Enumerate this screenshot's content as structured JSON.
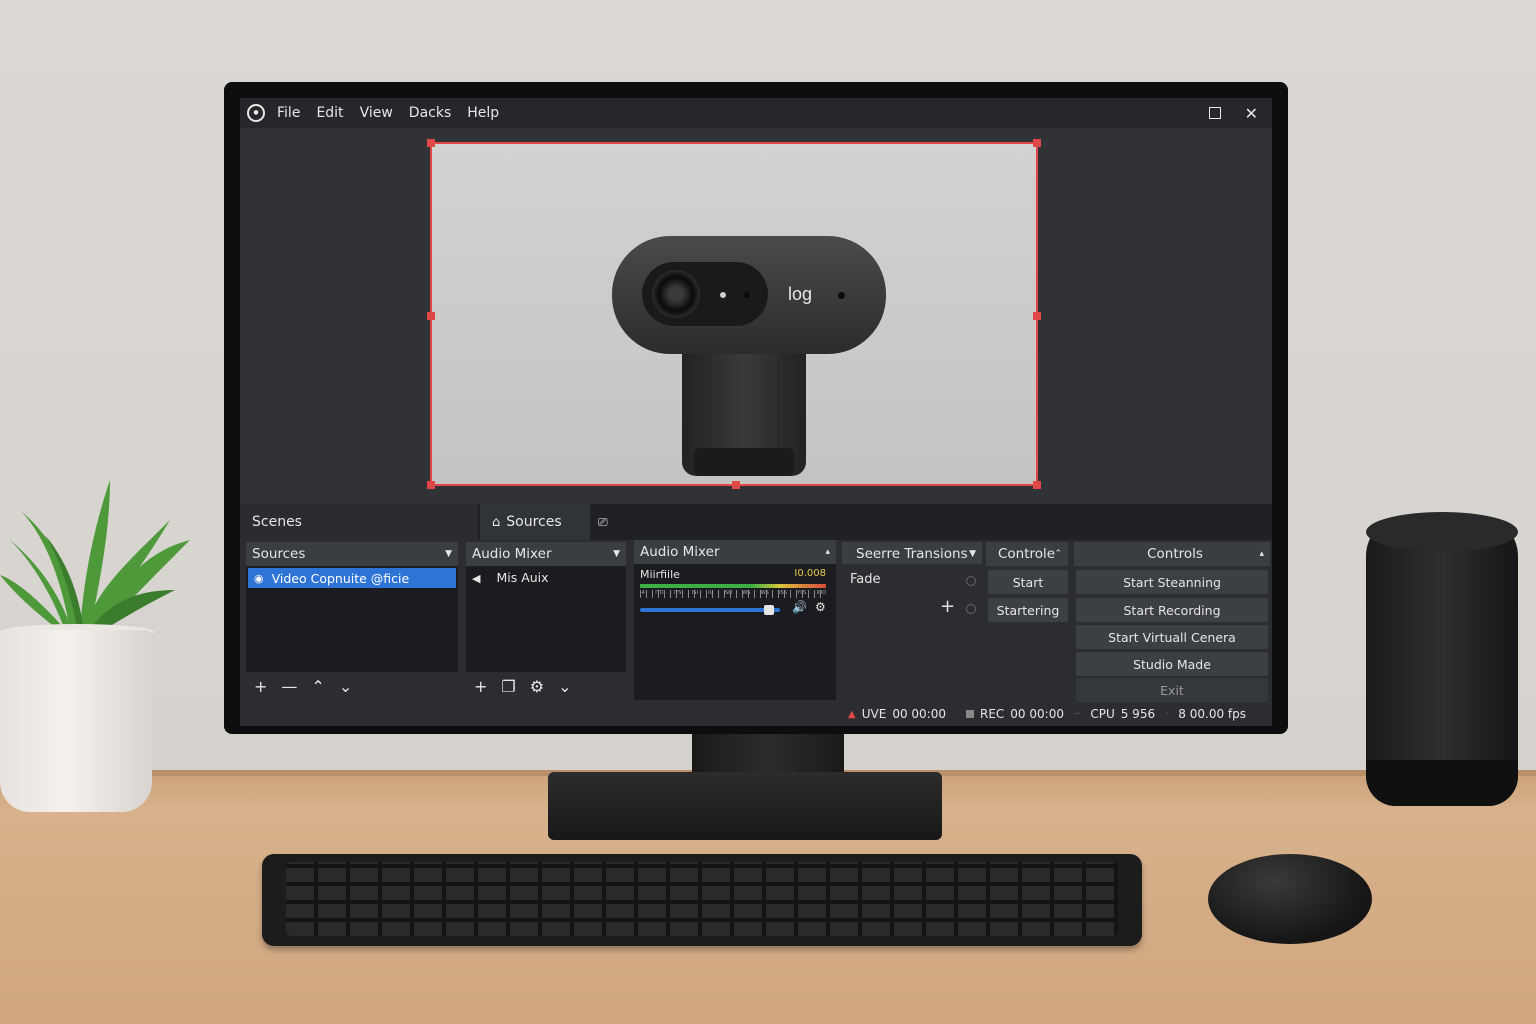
{
  "menu": {
    "items": [
      "File",
      "Edit",
      "View",
      "Dacks",
      "Help"
    ],
    "close_glyph": "✕"
  },
  "preview": {
    "cam_brand": "log"
  },
  "docks": {
    "scenes_tab": "Scenes",
    "sources_tab": "Sources"
  },
  "sources_panel": {
    "title": "Sources",
    "items": [
      "Video Copnuite @ficie"
    ]
  },
  "audio_mixer_panel": {
    "title": "Audio Mixer",
    "items": [
      "Mis Auix"
    ]
  },
  "audio_mixer_meter": {
    "title": "Audio Mixer",
    "channel_name": "Miirfiile",
    "level_readout": "I0.008",
    "tick_labels": [
      "-4",
      "ITD",
      "ITS",
      "ISI",
      "IU",
      "ISO",
      "WS",
      "WS",
      "ISS",
      "YIIS",
      "IOO"
    ]
  },
  "transitions_panel": {
    "title": "Seerre Transions",
    "selected": "Fade",
    "plus_glyph": "+"
  },
  "controle_panel": {
    "title": "Controle",
    "buttons": [
      "Start",
      "Startering"
    ]
  },
  "controls_panel": {
    "title": "Controls",
    "buttons": [
      "Start Steanning",
      "Start Recording",
      "Start Virtuall Cenera",
      "Studio Made",
      "Exit"
    ]
  },
  "statusbar": {
    "live_label": "UVE",
    "live_time": "00 00:00",
    "rec_label": "REC",
    "rec_time": "00 00:00",
    "cpu_label": "CPU",
    "cpu_value": "5 956",
    "fps_value": "8 00.00 fps"
  },
  "icons": {
    "app": "obs-logo-icon",
    "scene_tab": "house-icon",
    "extra_dock": "controller-icon",
    "add": "plus-icon",
    "remove": "minus-icon",
    "up": "chevron-up-icon",
    "down": "chevron-down-icon",
    "settings": "gear-icon",
    "speaker": "speaker-icon"
  },
  "colors": {
    "selection_blue": "#2e74d6",
    "canvas_border_red": "#e04848",
    "panel_bg": "#1b1c1f"
  },
  "meter": {
    "volume_fraction": 0.92
  }
}
